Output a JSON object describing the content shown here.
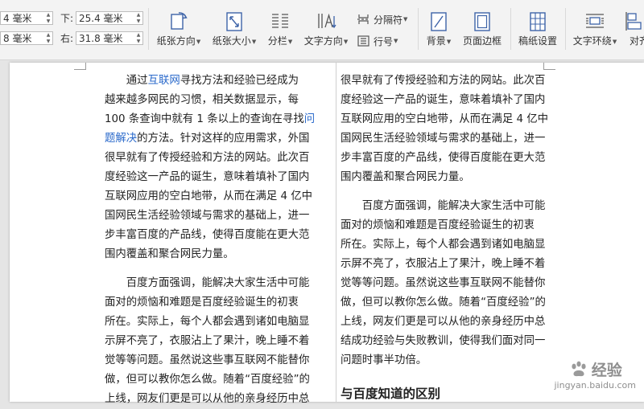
{
  "ribbon": {
    "margins": {
      "top_value": "4 毫米",
      "left_value": "8 毫米",
      "bottom_label": "下:",
      "bottom_value": "25.4 毫米",
      "right_label": "右:",
      "right_value": "31.8 毫米"
    },
    "orientation_label": "纸张方向",
    "size_label": "纸张大小",
    "columns_label": "分栏",
    "text_direction_label": "文字方向",
    "separator_label": "分隔符",
    "line_number_label": "行号",
    "background_label": "背景",
    "page_border_label": "页面边框",
    "manuscript_label": "稿纸设置",
    "text_wrap_label": "文字环绕",
    "align_label": "对齐"
  },
  "document": {
    "left_column": [
      {
        "first": true,
        "lines": [
          [
            {
              "t": "通过"
            },
            {
              "t": "互联网",
              "link": true
            },
            {
              "t": "寻找方法和经验已经成为"
            }
          ],
          [
            {
              "t": "越来越多网民的习惯，相关数据显示，每"
            }
          ],
          [
            {
              "t": "100 条查询中就有 1 条以上的查询在寻找"
            },
            {
              "t": "问",
              "link": true
            }
          ],
          [
            {
              "t": "题解决",
              "link": true
            },
            {
              "t": "的方法。针对这样的应用需求，外国"
            }
          ],
          [
            {
              "t": "很早就有了传授经验和方法的网站。此次百"
            }
          ],
          [
            {
              "t": "度经验这一产品的诞生，意味着填补了国内"
            }
          ],
          [
            {
              "t": "互联网应用的空白地带，从而在满足 4 亿中"
            }
          ],
          [
            {
              "t": "国网民生活经验领域与需求的基础上，进一"
            }
          ],
          [
            {
              "t": "步丰富百度的产品线，使得百度能在更大范"
            }
          ],
          [
            {
              "t": "围内覆盖和聚合网民力量。"
            }
          ]
        ]
      },
      {
        "first": true,
        "lines": [
          [
            {
              "t": "百度方面强调，能解决大家生活中可能"
            }
          ],
          [
            {
              "t": "面对的烦恼和难题是百度经验诞生的初衷"
            }
          ],
          [
            {
              "t": "所在。实际上，每个人都会遇到诸如电脑显"
            }
          ],
          [
            {
              "t": "示屏不亮了，衣服沾上了果汁，晚上睡不着"
            }
          ],
          [
            {
              "t": "觉等等问题。虽然说这些事互联网不能替你"
            }
          ],
          [
            {
              "t": "做，但可以教你怎么做。随着“百度经验”的"
            }
          ],
          [
            {
              "t": "上线，网友们更是可以从他的亲身经历中总"
            }
          ]
        ]
      }
    ],
    "right_column": [
      {
        "first": false,
        "lines": [
          [
            {
              "t": "很早就有了传授经验和方法的网站。此次百"
            }
          ],
          [
            {
              "t": "度经验这一产品的诞生，意味着填补了国内"
            }
          ],
          [
            {
              "t": "互联网应用的空白地带，从而在满足 4 亿中"
            }
          ],
          [
            {
              "t": "国网民生活经验领域与需求的基础上，进一"
            }
          ],
          [
            {
              "t": "步丰富百度的产品线，使得百度能在更大范"
            }
          ],
          [
            {
              "t": "围内覆盖和聚合网民力量。"
            }
          ]
        ]
      },
      {
        "first": true,
        "lines": [
          [
            {
              "t": "百度方面强调，能解决大家生活中可能"
            }
          ],
          [
            {
              "t": "面对的烦恼和难题是百度经验诞生的初衷"
            }
          ],
          [
            {
              "t": "所在。实际上，每个人都会遇到诸如电脑显"
            }
          ],
          [
            {
              "t": "示屏不亮了，衣服沾上了果汁，晚上睡不着"
            }
          ],
          [
            {
              "t": "觉等等问题。虽然说这些事互联网不能替你"
            }
          ],
          [
            {
              "t": "做，但可以教你怎么做。随着“百度经验”的"
            }
          ],
          [
            {
              "t": "上线，网友们更是可以从他的亲身经历中总"
            }
          ],
          [
            {
              "t": "结成功经验与失败教训，使得我们面对同一"
            }
          ],
          [
            {
              "t": "问题时事半功倍。"
            }
          ]
        ]
      }
    ],
    "right_heading": "与百度知道的区别"
  },
  "watermark": {
    "brand": "经验",
    "url": "jingyan.baidu.com"
  }
}
